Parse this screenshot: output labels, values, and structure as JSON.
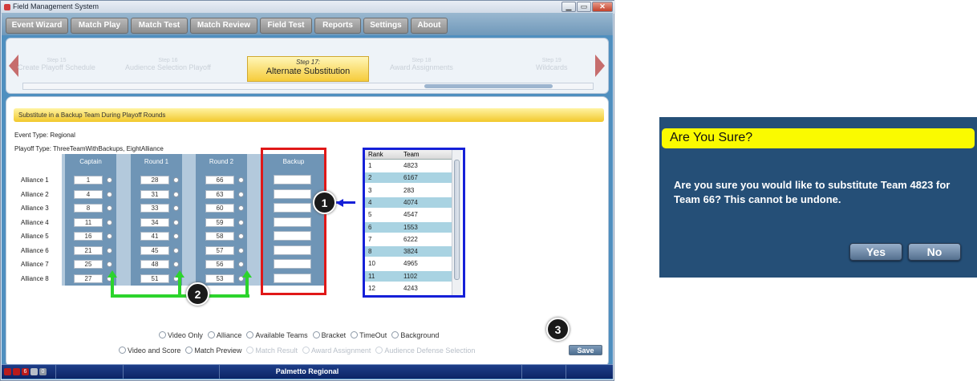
{
  "window": {
    "title": "Field Management System"
  },
  "menu": [
    "Event Wizard",
    "Match Play",
    "Match Test",
    "Match Review",
    "Field Test",
    "Reports",
    "Settings",
    "About"
  ],
  "steps": {
    "faded": [
      {
        "num": "Step 15",
        "name": "Create Playoff Schedule"
      },
      {
        "num": "Step 16",
        "name": "Audience Selection Playoff"
      },
      {
        "num": "Step 18",
        "name": "Award Assignments"
      },
      {
        "num": "Step 19",
        "name": "Wildcards"
      }
    ],
    "current_num": "Step 17:",
    "current_name": "Alternate Substitution"
  },
  "banner": "Substitute in a Backup Team During Playoff Rounds",
  "event_type": "Event Type: Regional",
  "playoff_type": "Playoff Type: ThreeTeamWithBackups, EightAlliance",
  "columns": [
    "Captain",
    "Round 1",
    "Round 2",
    "Backup"
  ],
  "alliances": [
    {
      "label": "Alliance 1",
      "captain": "1",
      "r1": "28",
      "r2": "66"
    },
    {
      "label": "Alliance 2",
      "captain": "4",
      "r1": "31",
      "r2": "63"
    },
    {
      "label": "Alliance 3",
      "captain": "8",
      "r1": "33",
      "r2": "60"
    },
    {
      "label": "Alliance 4",
      "captain": "11",
      "r1": "34",
      "r2": "59"
    },
    {
      "label": "Alliance 5",
      "captain": "16",
      "r1": "41",
      "r2": "58"
    },
    {
      "label": "Alliance 6",
      "captain": "21",
      "r1": "45",
      "r2": "57"
    },
    {
      "label": "Alliance 7",
      "captain": "25",
      "r1": "48",
      "r2": "56"
    },
    {
      "label": "Alliance 8",
      "captain": "27",
      "r1": "51",
      "r2": "53"
    }
  ],
  "rank_list": {
    "headers": [
      "Rank",
      "Team"
    ],
    "rows": [
      [
        "1",
        "4823"
      ],
      [
        "2",
        "6167"
      ],
      [
        "3",
        "283"
      ],
      [
        "4",
        "4074"
      ],
      [
        "5",
        "4547"
      ],
      [
        "6",
        "1553"
      ],
      [
        "7",
        "6222"
      ],
      [
        "8",
        "3824"
      ],
      [
        "10",
        "4965"
      ],
      [
        "11",
        "1102"
      ],
      [
        "12",
        "4243"
      ]
    ]
  },
  "callouts": [
    "1",
    "2",
    "3"
  ],
  "radio_row1": [
    "Video Only",
    "Alliance",
    "Available Teams",
    "Bracket",
    "TimeOut",
    "Background"
  ],
  "radio_row2": [
    {
      "label": "Video and Score",
      "disabled": false
    },
    {
      "label": "Match Preview",
      "disabled": false
    },
    {
      "label": "Match Result",
      "disabled": true
    },
    {
      "label": "Award Assignment",
      "disabled": true
    },
    {
      "label": "Audience Defense Selection",
      "disabled": true
    }
  ],
  "save_label": "Save",
  "status": {
    "event_name": "Palmetto Regional",
    "counter_red": "6",
    "counter_grey": "0"
  },
  "dialog": {
    "title": "Are You Sure?",
    "message": "Are you sure you would like to substitute Team 4823 for Team 66? This cannot be undone.",
    "yes": "Yes",
    "no": "No"
  },
  "colors": {
    "accent_yellow": "#fafa00",
    "dialog_bg": "#254f77",
    "red_box": "#e01818",
    "blue_box": "#1520d8",
    "green_arrow": "#2cd42c"
  },
  "icons": [
    "app-icon",
    "minimize-icon",
    "maximize-icon",
    "close-icon",
    "left-arrow-icon",
    "right-arrow-icon"
  ]
}
